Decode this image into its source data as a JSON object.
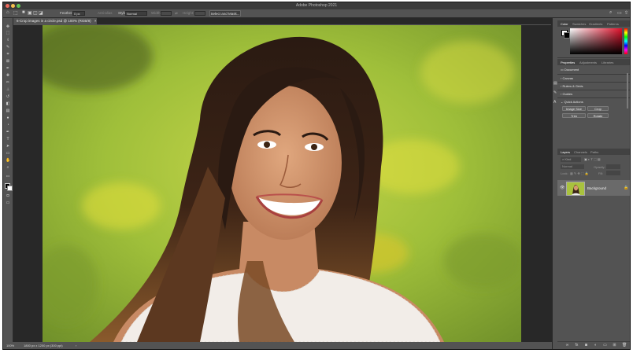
{
  "app": {
    "title": "Adobe Photoshop 2021"
  },
  "options_bar": {
    "feather_label": "Feather:",
    "feather_value": "0 px",
    "antialias_label": "Anti-alias",
    "style_label": "Style:",
    "style_value": "Normal",
    "width_label": "Width:",
    "height_label": "Height:",
    "select_mask_label": "Select and Mask..."
  },
  "document": {
    "tab_title": "6-Crop images in a circle.psd @ 100% (RGB/8)",
    "tab_close": "×"
  },
  "status": {
    "zoom": "100%",
    "info": "1800 px x 1200 px (300 ppi)"
  },
  "color_panel": {
    "tabs": [
      "Color",
      "Swatches",
      "Gradients",
      "Patterns"
    ],
    "hue_colors": [
      "#ff0000",
      "#ffff00",
      "#00ff00",
      "#00ffff",
      "#0000ff",
      "#ff00ff",
      "#ff0000"
    ],
    "field_color": "#e0102a"
  },
  "properties_panel": {
    "tabs": [
      "Properties",
      "Adjustments",
      "Libraries"
    ],
    "doc_label": "Document",
    "sections": [
      "Canvas",
      "Rulers & Grids",
      "Guides",
      "Quick Actions"
    ],
    "buttons": [
      "Image Size",
      "Crop",
      "Trim",
      "Rotate"
    ]
  },
  "layers_panel": {
    "tabs": [
      "Layers",
      "Channels",
      "Paths"
    ],
    "kind_placeholder": "Kind",
    "blend_mode": "Normal",
    "opacity_label": "Opacity:",
    "lock_label": "Lock:",
    "fill_label": "Fill:",
    "layers": [
      {
        "name": "Background",
        "visible": true,
        "locked": true
      }
    ]
  },
  "tools": [
    {
      "name": "move-tool",
      "glyph": "✥"
    },
    {
      "name": "marquee-tool",
      "glyph": "⬚"
    },
    {
      "name": "lasso-tool",
      "glyph": "ℓ"
    },
    {
      "name": "quick-select-tool",
      "glyph": "✎"
    },
    {
      "name": "crop-tool",
      "glyph": "⌗"
    },
    {
      "name": "frame-tool",
      "glyph": "⊠"
    },
    {
      "name": "eyedropper-tool",
      "glyph": "✒"
    },
    {
      "name": "healing-tool",
      "glyph": "✚"
    },
    {
      "name": "brush-tool",
      "glyph": "✏"
    },
    {
      "name": "stamp-tool",
      "glyph": "⊥"
    },
    {
      "name": "history-brush-tool",
      "glyph": "↺"
    },
    {
      "name": "eraser-tool",
      "glyph": "◧"
    },
    {
      "name": "gradient-tool",
      "glyph": "▤"
    },
    {
      "name": "blur-tool",
      "glyph": "●"
    },
    {
      "name": "dodge-tool",
      "glyph": "◔"
    },
    {
      "name": "pen-tool",
      "glyph": "✒"
    },
    {
      "name": "type-tool",
      "glyph": "T"
    },
    {
      "name": "path-select-tool",
      "glyph": "➤"
    },
    {
      "name": "shape-tool",
      "glyph": "▭"
    },
    {
      "name": "hand-tool",
      "glyph": "✋"
    },
    {
      "name": "zoom-tool",
      "glyph": "⌕"
    },
    {
      "name": "more-tools",
      "glyph": "•••"
    }
  ]
}
